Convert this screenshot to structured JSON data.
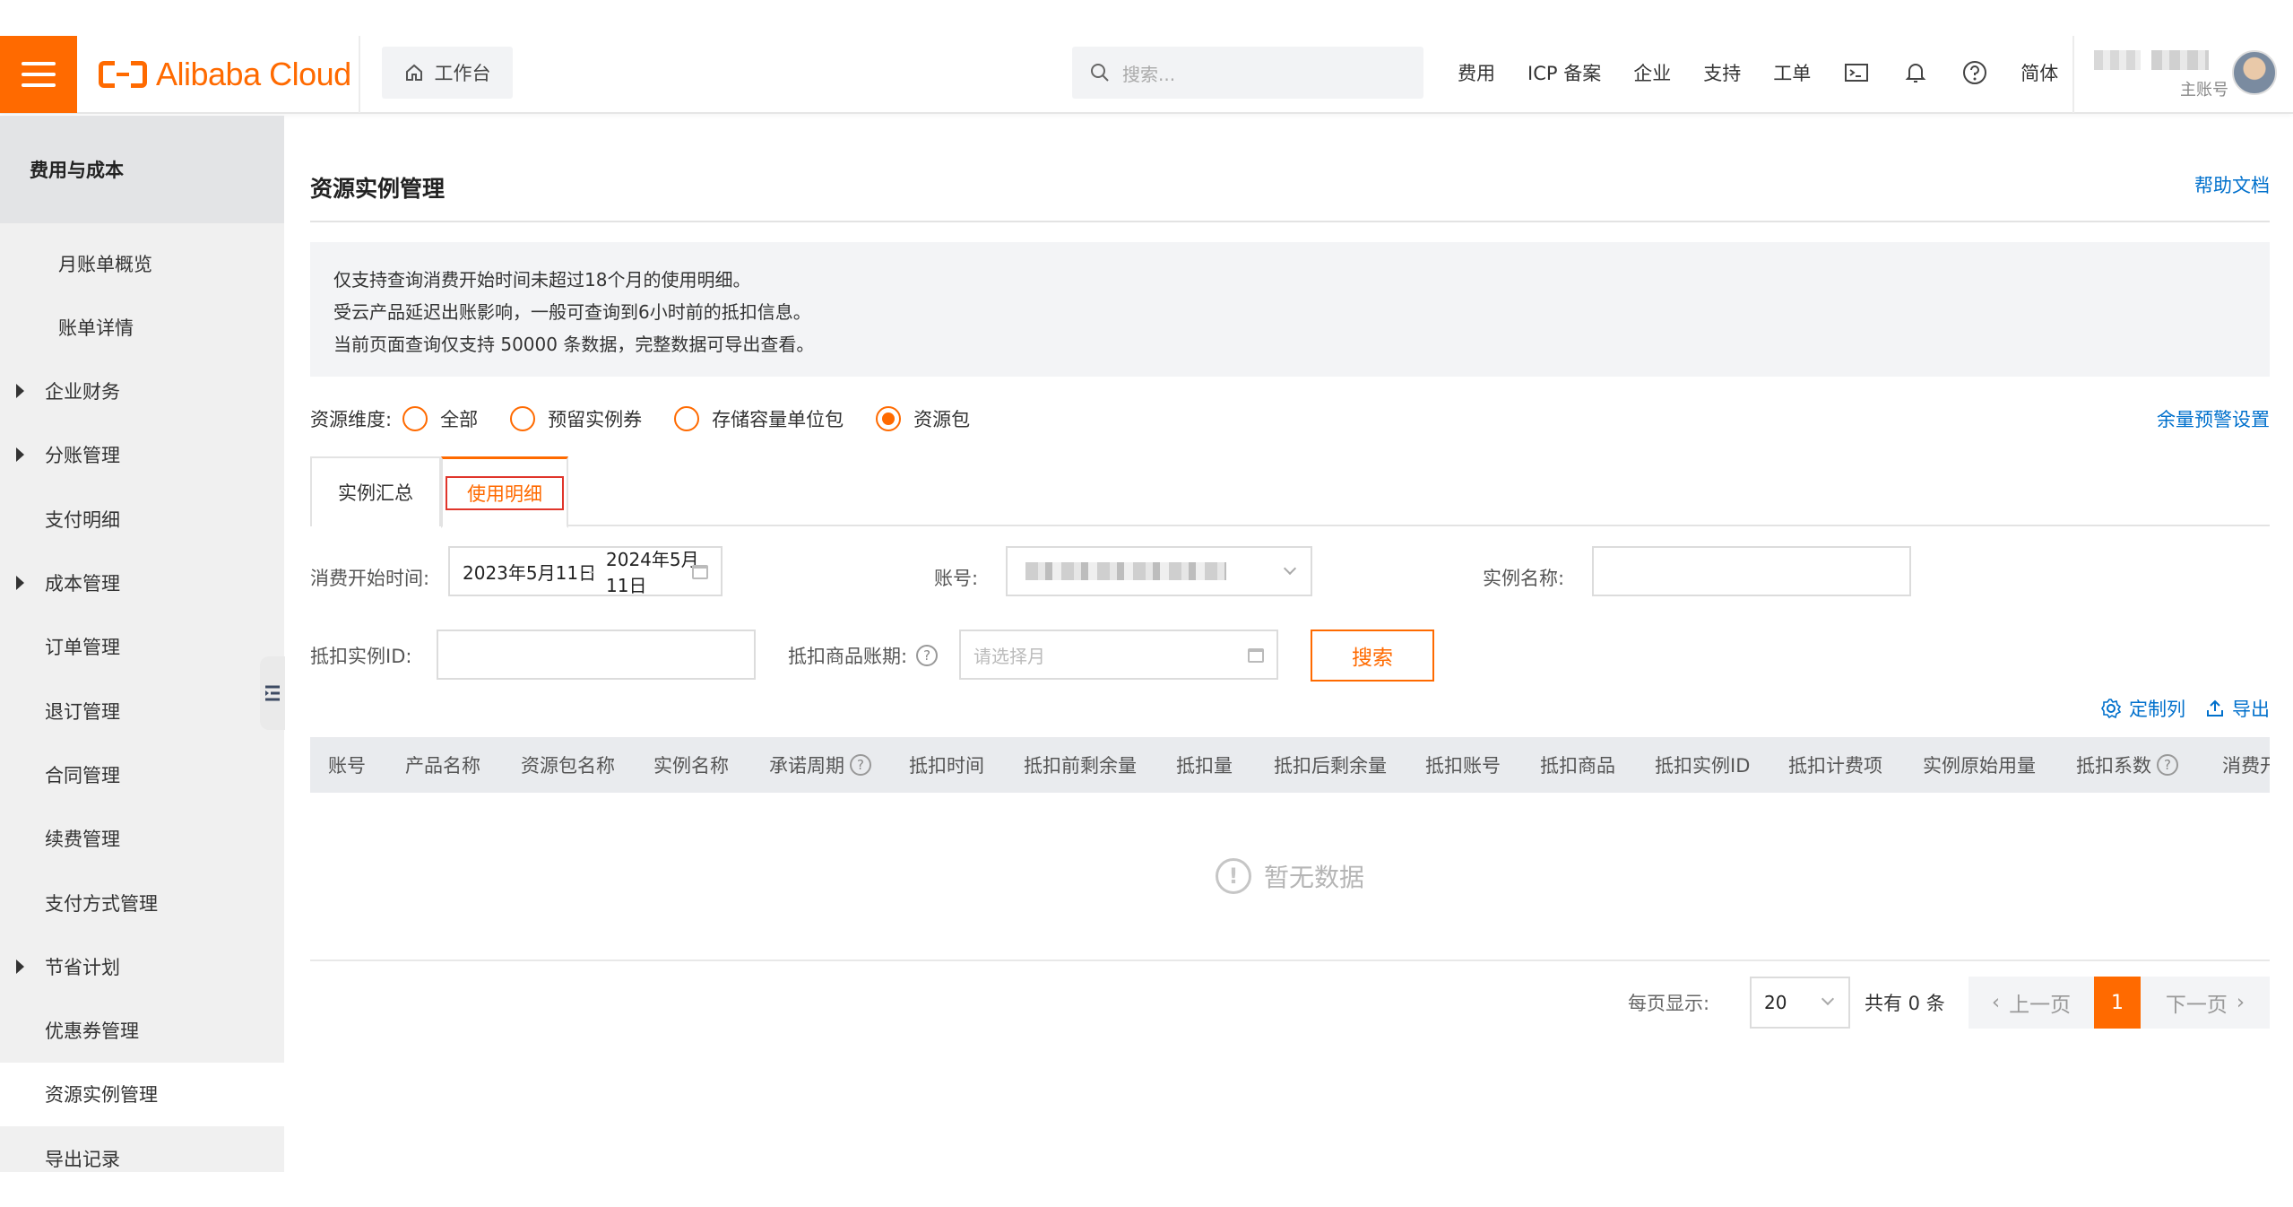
{
  "header": {
    "logo_text": "Alibaba Cloud",
    "workbench_label": "工作台",
    "search_placeholder": "搜索...",
    "nav": [
      "费用",
      "ICP 备案",
      "企业",
      "支持",
      "工单"
    ],
    "lang": "简体",
    "account_role": "主账号"
  },
  "sidebar": {
    "title": "费用与成本",
    "items": [
      {
        "label": "月账单概览",
        "expandable": false,
        "indent": true
      },
      {
        "label": "账单详情",
        "expandable": false,
        "indent": true
      },
      {
        "label": "企业财务",
        "expandable": true
      },
      {
        "label": "分账管理",
        "expandable": true
      },
      {
        "label": "支付明细",
        "expandable": false
      },
      {
        "label": "成本管理",
        "expandable": true
      },
      {
        "label": "订单管理",
        "expandable": false
      },
      {
        "label": "退订管理",
        "expandable": false
      },
      {
        "label": "合同管理",
        "expandable": false
      },
      {
        "label": "续费管理",
        "expandable": false
      },
      {
        "label": "支付方式管理",
        "expandable": false
      },
      {
        "label": "节省计划",
        "expandable": true
      },
      {
        "label": "优惠券管理",
        "expandable": false
      },
      {
        "label": "资源实例管理",
        "expandable": false,
        "active": true
      },
      {
        "label": "导出记录",
        "expandable": false
      }
    ]
  },
  "page": {
    "title": "资源实例管理",
    "help_link": "帮助文档",
    "notice": [
      "仅支持查询消费开始时间未超过18个月的使用明细。",
      "受云产品延迟出账影响，一般可查询到6小时前的抵扣信息。",
      "当前页面查询仅支持 50000 条数据，完整数据可导出查看。"
    ],
    "dimension_label": "资源维度:",
    "dimensions": [
      "全部",
      "预留实例券",
      "存储容量单位包",
      "资源包"
    ],
    "dimension_selected": "资源包",
    "alert_setting": "余量预警设置",
    "tabs": [
      "实例汇总",
      "使用明细"
    ],
    "active_tab": "使用明细"
  },
  "filters": {
    "start_time_label": "消费开始时间:",
    "start_date": "2023年5月11日",
    "date_sep": "-",
    "end_date": "2024年5月11日",
    "account_label": "账号:",
    "instance_name_label": "实例名称:",
    "deduct_instance_label": "抵扣实例ID:",
    "deduct_period_label": "抵扣商品账期:",
    "period_placeholder": "请选择月",
    "search_button": "搜索"
  },
  "table": {
    "customize": "定制列",
    "export": "导出",
    "columns": [
      {
        "label": "账号",
        "help": false
      },
      {
        "label": "产品名称",
        "help": false
      },
      {
        "label": "资源包名称",
        "help": false
      },
      {
        "label": "实例名称",
        "help": false
      },
      {
        "label": "承诺周期",
        "help": true
      },
      {
        "label": "抵扣时间",
        "help": false
      },
      {
        "label": "抵扣前剩余量",
        "help": false
      },
      {
        "label": "抵扣量",
        "help": false
      },
      {
        "label": "抵扣后剩余量",
        "help": false
      },
      {
        "label": "抵扣账号",
        "help": false
      },
      {
        "label": "抵扣商品",
        "help": false
      },
      {
        "label": "抵扣实例ID",
        "help": false
      },
      {
        "label": "抵扣计费项",
        "help": false
      },
      {
        "label": "实例原始用量",
        "help": false
      },
      {
        "label": "抵扣系数",
        "help": true
      },
      {
        "label": "消费开",
        "help": false
      }
    ],
    "empty_text": "暂无数据"
  },
  "pagination": {
    "page_size_label": "每页显示:",
    "page_size": "20",
    "total_text": "共有 0 条",
    "prev": "上一页",
    "current": "1",
    "next": "下一页"
  },
  "colors": {
    "brand": "#ff6a00",
    "link": "#0070cc",
    "tab_highlight": "#e0352b"
  }
}
